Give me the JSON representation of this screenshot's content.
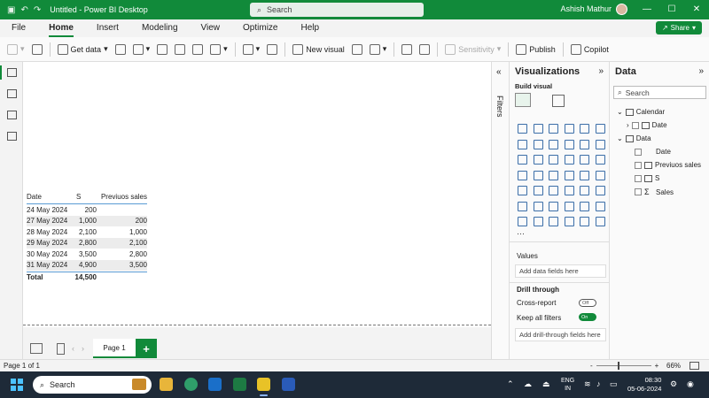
{
  "titlebar": {
    "title": "Untitled - Power BI Desktop",
    "search_placeholder": "Search",
    "user": "Ashish Mathur",
    "min": "—",
    "max": "☐",
    "close": "✕"
  },
  "menu": {
    "tabs": [
      "File",
      "Home",
      "Insert",
      "Modeling",
      "View",
      "Optimize",
      "Help"
    ],
    "share": "Share"
  },
  "ribbon": {
    "get_data": "Get data",
    "new_visual": "New visual",
    "sensitivity": "Sensitivity",
    "publish": "Publish",
    "copilot": "Copilot"
  },
  "table": {
    "headers": [
      "Date",
      "S",
      "Previuos sales"
    ],
    "rows": [
      [
        "24 May 2024",
        "200",
        ""
      ],
      [
        "27 May 2024",
        "1,000",
        "200"
      ],
      [
        "28 May 2024",
        "2,100",
        "1,000"
      ],
      [
        "29 May 2024",
        "2,800",
        "2,100"
      ],
      [
        "30 May 2024",
        "3,500",
        "2,800"
      ],
      [
        "31 May 2024",
        "4,900",
        "3,500"
      ]
    ],
    "total": [
      "Total",
      "14,500",
      ""
    ]
  },
  "pages": {
    "page1": "Page 1",
    "add": "+"
  },
  "filters": {
    "label": "Filters"
  },
  "visualizations": {
    "title": "Visualizations",
    "build": "Build visual",
    "more": "···",
    "values_label": "Values",
    "values_placeholder": "Add data fields here",
    "drill_title": "Drill through",
    "cross_report": "Cross-report",
    "cross_report_state": "Off",
    "keep_filters": "Keep all filters",
    "keep_filters_state": "On",
    "drill_placeholder": "Add drill-through fields here"
  },
  "data_pane": {
    "title": "Data",
    "search_placeholder": "Search",
    "calendar": "Calendar",
    "calendar_date": "Date",
    "data_table": "Data",
    "fields": [
      "Date",
      "Previuos sales",
      "S",
      "Sales"
    ]
  },
  "statusbar": {
    "page": "Page 1 of 1",
    "zoom_minus": "-",
    "zoom_plus": "+",
    "zoom_pct": "66%"
  },
  "taskbar": {
    "search": "Search",
    "lang1": "ENG",
    "lang2": "IN",
    "time": "08:30",
    "date": "05-06-2024"
  },
  "colors": {
    "accent": "#118a3a",
    "taskbar": "#1e2a38"
  }
}
